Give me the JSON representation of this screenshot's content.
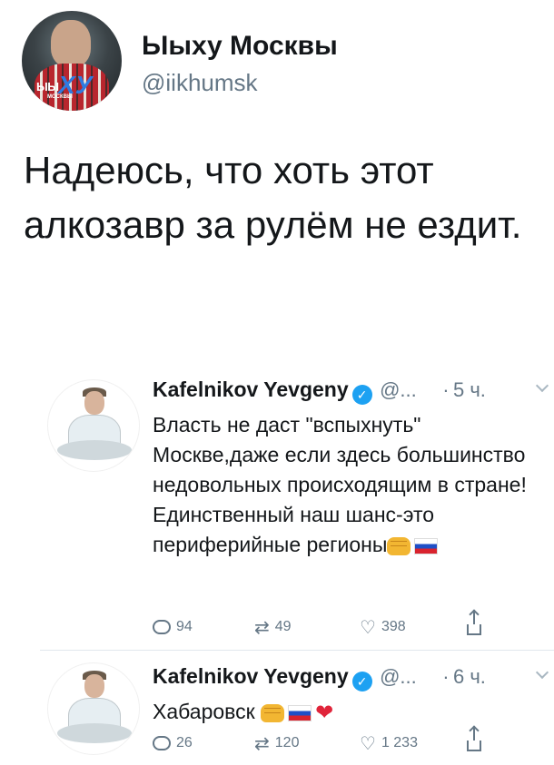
{
  "author": {
    "display_name": "Ыыху Москвы",
    "handle": "@iikhumsk",
    "avatar_logo": {
      "ya": "ЫЫ",
      "hu": "ХУ",
      "msk": "МОСКВЫ"
    }
  },
  "tweet": {
    "text": "Надеюсь, что хоть этот алкозавр за рулём не ездит."
  },
  "quoted_tweets": [
    {
      "name": "Kafelnikov Yevgeny",
      "handle": "@...",
      "dot": "·",
      "time": "5 ч.",
      "text": "Власть не даст \"вспыхнуть\" Москве,даже если здесь большинство недовольных происходящим в стране! Единственный наш шанс-это периферийные регионы",
      "emoji": [
        "fist-emoji",
        "russia-flag-emoji"
      ],
      "replies": "94",
      "retweets": "49",
      "likes": "398"
    },
    {
      "name": "Kafelnikov Yevgeny",
      "handle": "@...",
      "dot": "·",
      "time": "6 ч.",
      "text": "Хабаровск",
      "emoji": [
        "fist-emoji",
        "russia-flag-emoji",
        "heart-emoji"
      ],
      "replies": "26",
      "retweets": "120",
      "likes": "1 233"
    }
  ],
  "icons": {
    "verified": "verified-badge-icon",
    "reply": "reply-icon",
    "retweet": "retweet-icon",
    "like": "heart-icon",
    "share": "share-icon",
    "menu": "chevron-down-icon"
  },
  "colors": {
    "text": "#14171a",
    "secondary": "#657786",
    "verified": "#1da1f2",
    "separator": "#e1e8ed"
  }
}
